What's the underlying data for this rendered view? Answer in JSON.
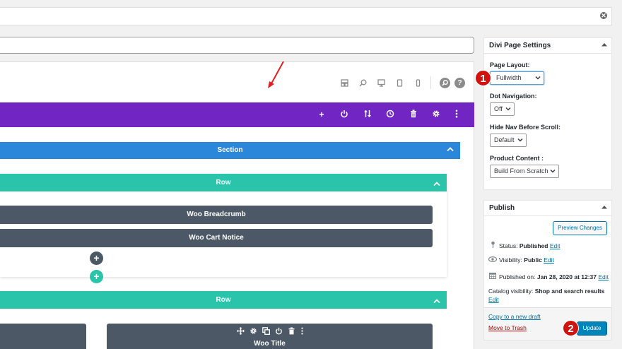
{
  "builder": {
    "section_label": "Section",
    "rows": [
      {
        "label": "Row",
        "modules": [
          "Woo Breadcrumb",
          "Woo Cart Notice"
        ]
      },
      {
        "label": "Row",
        "modules": [
          "Woo Title"
        ]
      }
    ],
    "view_icons": [
      "wireframe-icon",
      "zoom-icon",
      "desktop-icon",
      "tablet-icon",
      "phone-icon"
    ],
    "round_icons": [
      "search-icon",
      "help-icon"
    ],
    "section_icons": [
      "plus-icon",
      "power-icon",
      "sort-icon",
      "history-icon",
      "trash-icon",
      "gear-icon",
      "more-icon"
    ],
    "module_icons": [
      "move-icon",
      "gear-icon",
      "duplicate-icon",
      "power-icon",
      "trash-icon",
      "more-icon"
    ],
    "add_module": "+",
    "add_row": "+",
    "colors": {
      "section_bar": "#7126c4",
      "section": "#2b87da",
      "row": "#29c4a9",
      "module": "#4c5866"
    }
  },
  "divi_settings": {
    "title": "Divi Page Settings",
    "page_layout_label": "Page Layout:",
    "page_layout_value": "Fullwidth",
    "dot_nav_label": "Dot Navigation:",
    "dot_nav_value": "Off",
    "hide_nav_label": "Hide Nav Before Scroll:",
    "hide_nav_value": "Default",
    "product_content_label": "Product Content :",
    "product_content_value": "Build From Scratch"
  },
  "publish": {
    "title": "Publish",
    "preview_button": "Preview Changes",
    "status_label": "Status:",
    "status_value": "Published",
    "visibility_label": "Visibility:",
    "visibility_value": "Public",
    "published_on_label": "Published on:",
    "published_on_value": "Jan 28, 2020 at 12:37",
    "catalog_label": "Catalog visibility:",
    "catalog_value": "Shop and search results",
    "edit_link": "Edit",
    "copy_draft": "Copy to a new draft",
    "move_trash": "Move to Trash",
    "update_button": "Update"
  },
  "badges": [
    "1",
    "2"
  ],
  "close_icon": "✕"
}
